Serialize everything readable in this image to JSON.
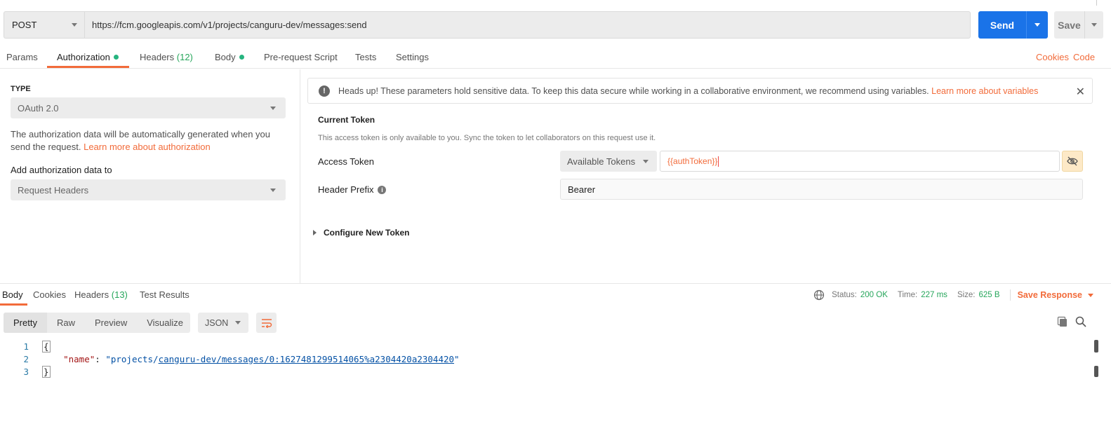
{
  "request": {
    "method": "POST",
    "url": "https://fcm.googleapis.com/v1/projects/canguru-dev/messages:send",
    "send_label": "Send",
    "save_label": "Save"
  },
  "req_tabs": {
    "params": "Params",
    "authorization": "Authorization",
    "headers": "Headers",
    "headers_count": "(12)",
    "body": "Body",
    "prerequest": "Pre-request Script",
    "tests": "Tests",
    "settings": "Settings",
    "cookies": "Cookies",
    "code": "Code"
  },
  "auth": {
    "type_label": "TYPE",
    "type_value": "OAuth 2.0",
    "description": "The authorization data will be automatically generated when you send the request.",
    "learn_more": "Learn more about authorization",
    "add_to_label": "Add authorization data to",
    "add_to_value": "Request Headers"
  },
  "banner": {
    "text": "Heads up! These parameters hold sensitive data. To keep this data secure while working in a collaborative environment, we recommend using variables.",
    "link": "Learn more about variables"
  },
  "token": {
    "title": "Current Token",
    "description": "This access token is only available to you. Sync the token to let collaborators on this request use it.",
    "access_label": "Access Token",
    "available_tokens": "Available Tokens",
    "access_value": "{{authToken}}",
    "prefix_label": "Header Prefix",
    "prefix_value": "Bearer",
    "configure": "Configure New Token"
  },
  "response": {
    "tabs": {
      "body": "Body",
      "cookies": "Cookies",
      "headers": "Headers",
      "headers_count": "(13)",
      "test_results": "Test Results"
    },
    "status_label": "Status:",
    "status_value": "200 OK",
    "time_label": "Time:",
    "time_value": "227 ms",
    "size_label": "Size:",
    "size_value": "625 B",
    "save_response": "Save Response",
    "views": [
      "Pretty",
      "Raw",
      "Preview",
      "Visualize"
    ],
    "format": "JSON",
    "code": {
      "line1": "{",
      "key": "\"name\"",
      "colon": ": ",
      "str_prefix": "\"projects/",
      "str_link": "canguru-dev/messages/0:1627481299514065%a2304420a2304420",
      "str_suffix": "\"",
      "line3": "}",
      "n1": "1",
      "n2": "2",
      "n3": "3"
    }
  },
  "colors": {
    "accent": "#f26b3a",
    "send": "#1a73e8",
    "success": "#26a65b"
  }
}
